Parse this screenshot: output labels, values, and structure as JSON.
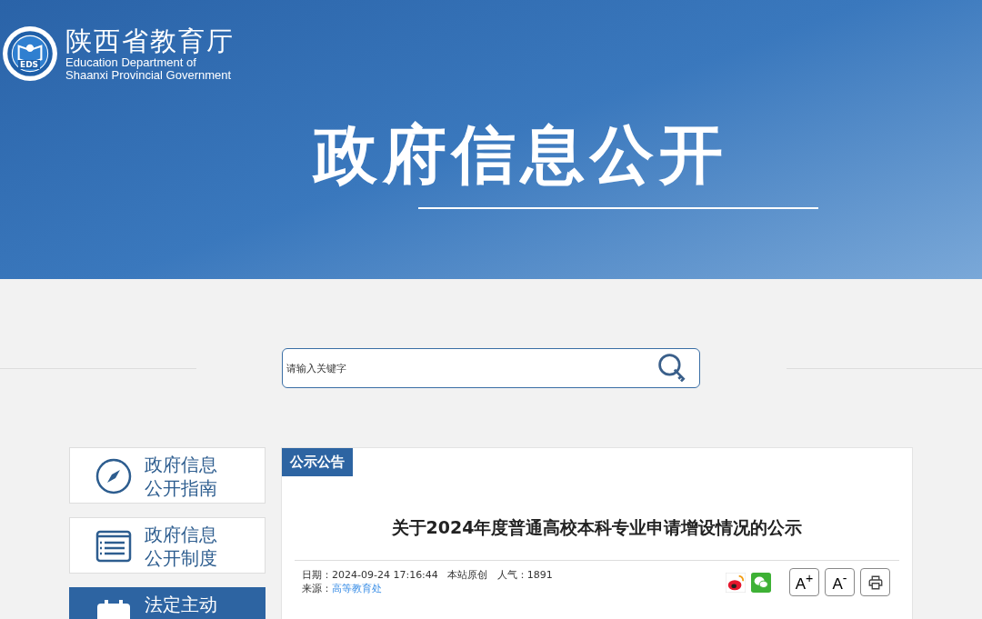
{
  "header": {
    "logo_badge": "EDS",
    "org_name": "陕西省教育厅",
    "org_name_en_line1": "Education Department of",
    "org_name_en_line2": "Shaanxi Provincial Government",
    "banner_title": "政府信息公开"
  },
  "search": {
    "placeholder": "请输入关键字"
  },
  "sidebar": {
    "items": [
      {
        "kind": "compass",
        "line1": "政府信息",
        "line2": "公开指南",
        "selected": false
      },
      {
        "kind": "list",
        "line1": "政府信息",
        "line2": "公开制度",
        "selected": false
      },
      {
        "kind": "calendar",
        "line1": "法定主动",
        "selected": true
      }
    ]
  },
  "article": {
    "category": "公示公告",
    "title": "关于2024年度普通高校本科专业申请增设情况的公示",
    "date_label": "日期：",
    "date": "2024-09-24 17:16:44",
    "origin": "本站原创",
    "views_label": "人气：",
    "views": "1891",
    "source_label": "来源：",
    "source": "高等教育处",
    "tools": [
      {
        "kind": "weibo"
      },
      {
        "kind": "wechat"
      },
      {
        "kind": "text",
        "label": "A$^{+}$"
      },
      {
        "kind": "text",
        "label": "A$^{-}$"
      },
      {
        "kind": "print"
      }
    ]
  }
}
